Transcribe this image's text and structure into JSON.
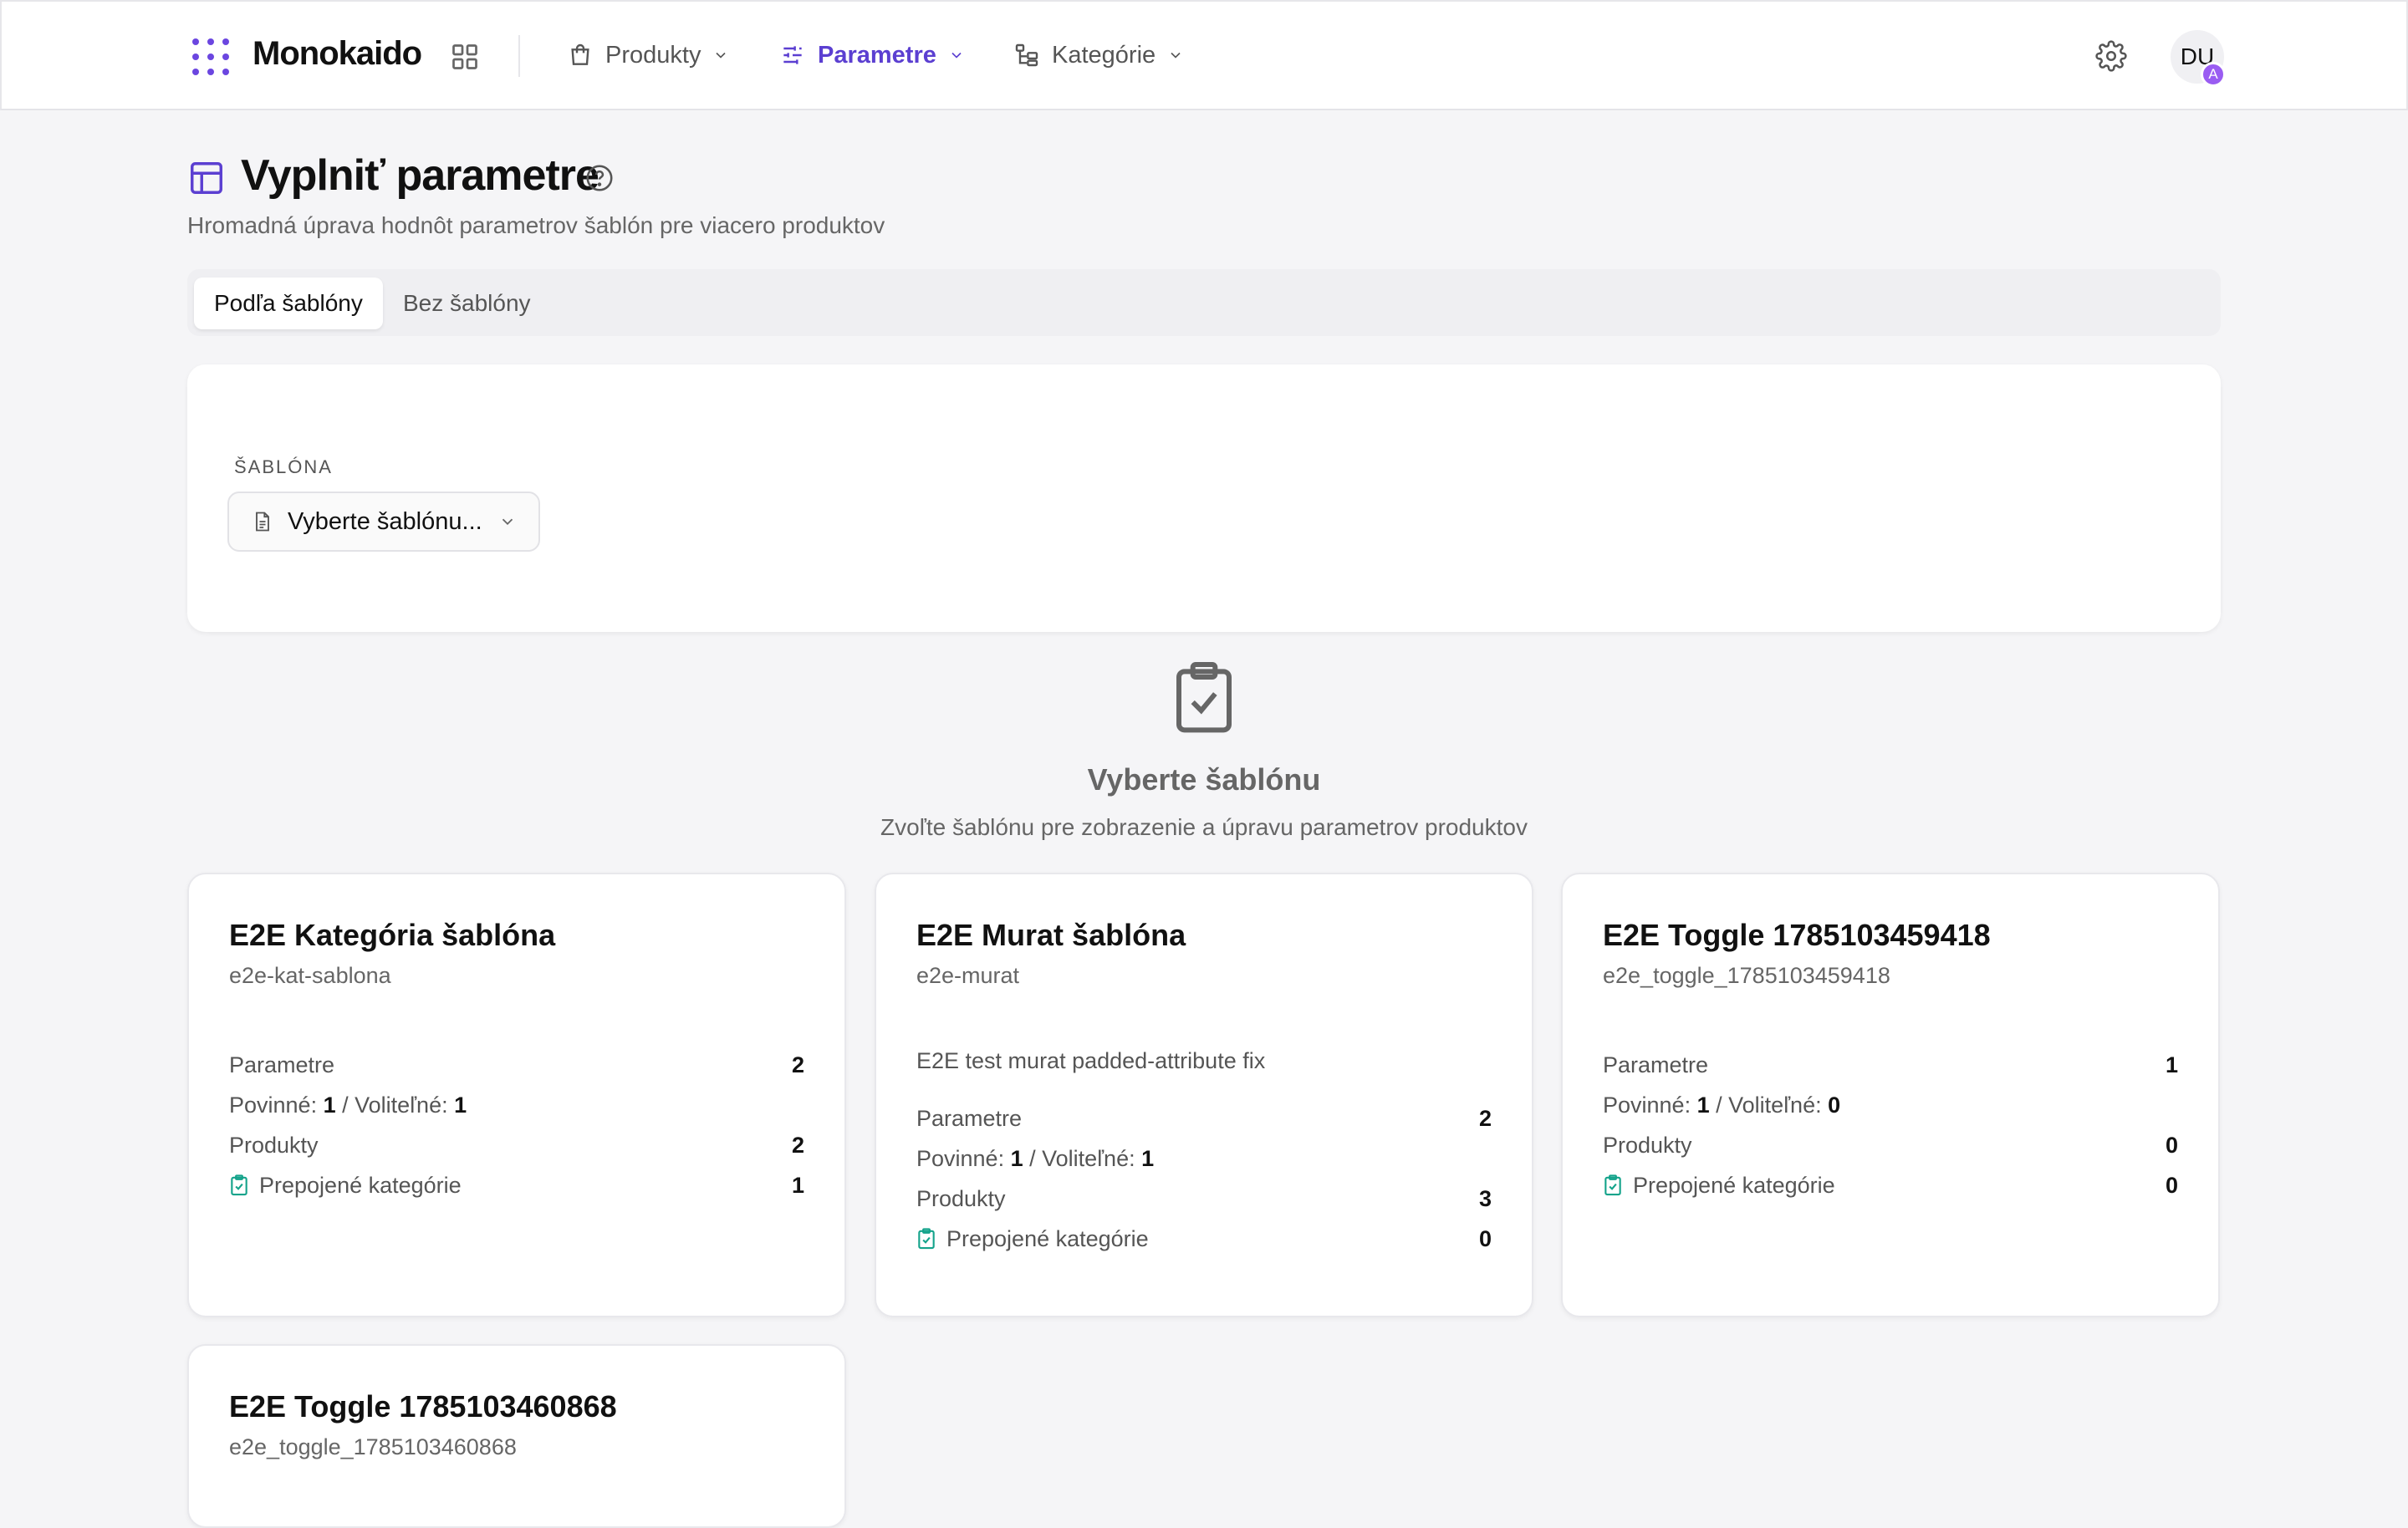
{
  "header": {
    "brand": "Monokaido",
    "nav": [
      {
        "label": "Produkty",
        "icon": "shopping-bag-icon"
      },
      {
        "label": "Parametre",
        "icon": "sliders-icon",
        "active": true
      },
      {
        "label": "Kategórie",
        "icon": "category-tree-icon"
      }
    ],
    "avatar_initials": "DU",
    "avatar_badge": "A",
    "accent_color": "#5b3fd1"
  },
  "page": {
    "title": "Vyplniť parametre",
    "subtitle": "Hromadná úprava hodnôt parametrov šablón pre viacero produktov"
  },
  "tabs": [
    {
      "label": "Podľa šablóny",
      "active": true
    },
    {
      "label": "Bez šablóny",
      "active": false
    }
  ],
  "template_select": {
    "label": "ŠABLÓNA",
    "placeholder": "Vyberte šablónu..."
  },
  "empty_state": {
    "title": "Vyberte šablónu",
    "subtitle": "Zvoľte šablónu pre zobrazenie a úpravu parametrov produktov"
  },
  "labels": {
    "parameters": "Parametre",
    "required": "Povinné:",
    "optional": "Voliteľné:",
    "products": "Produkty",
    "linked_categories": "Prepojené kategórie"
  },
  "templates": [
    {
      "name": "E2E Kategória šablóna",
      "slug": "e2e-kat-sablona",
      "description": "",
      "parameters": "2",
      "required": "1",
      "optional": "1",
      "products": "2",
      "linked_categories": "1"
    },
    {
      "name": "E2E Murat šablóna",
      "slug": "e2e-murat",
      "description": "E2E test murat padded-attribute fix",
      "parameters": "2",
      "required": "1",
      "optional": "1",
      "products": "3",
      "linked_categories": "0"
    },
    {
      "name": "E2E Toggle 1785103459418",
      "slug": "e2e_toggle_1785103459418",
      "description": "",
      "parameters": "1",
      "required": "1",
      "optional": "0",
      "products": "0",
      "linked_categories": "0"
    },
    {
      "name": "E2E Toggle 1785103460868",
      "slug": "e2e_toggle_1785103460868"
    }
  ]
}
